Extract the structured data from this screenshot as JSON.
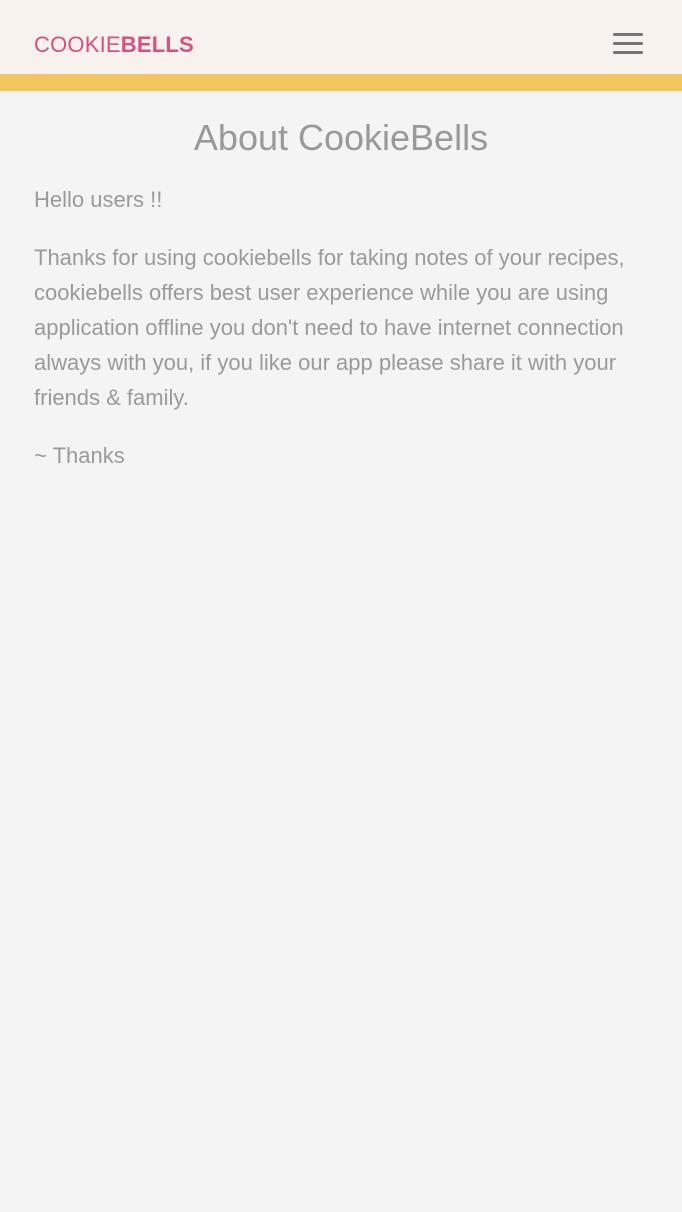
{
  "header": {
    "logo_light": "COOKIE",
    "logo_bold": "BELLS",
    "menu_icon": "hamburger-menu-icon"
  },
  "about": {
    "title": "About CookieBells",
    "greeting": "Hello users !!",
    "body": "Thanks for using cookiebells for taking notes of your recipes, cookiebells offers best user experience while you are using application offline you don't need to have internet connection always with you, if you like our app please share it with your friends & family.",
    "signoff": "~ Thanks"
  },
  "colors": {
    "brand": "#d94f7f",
    "accent": "#f2c55d",
    "header_background": "#f8f2ef",
    "page_background": "#f4f4f4",
    "text": "#9a9a9a"
  }
}
